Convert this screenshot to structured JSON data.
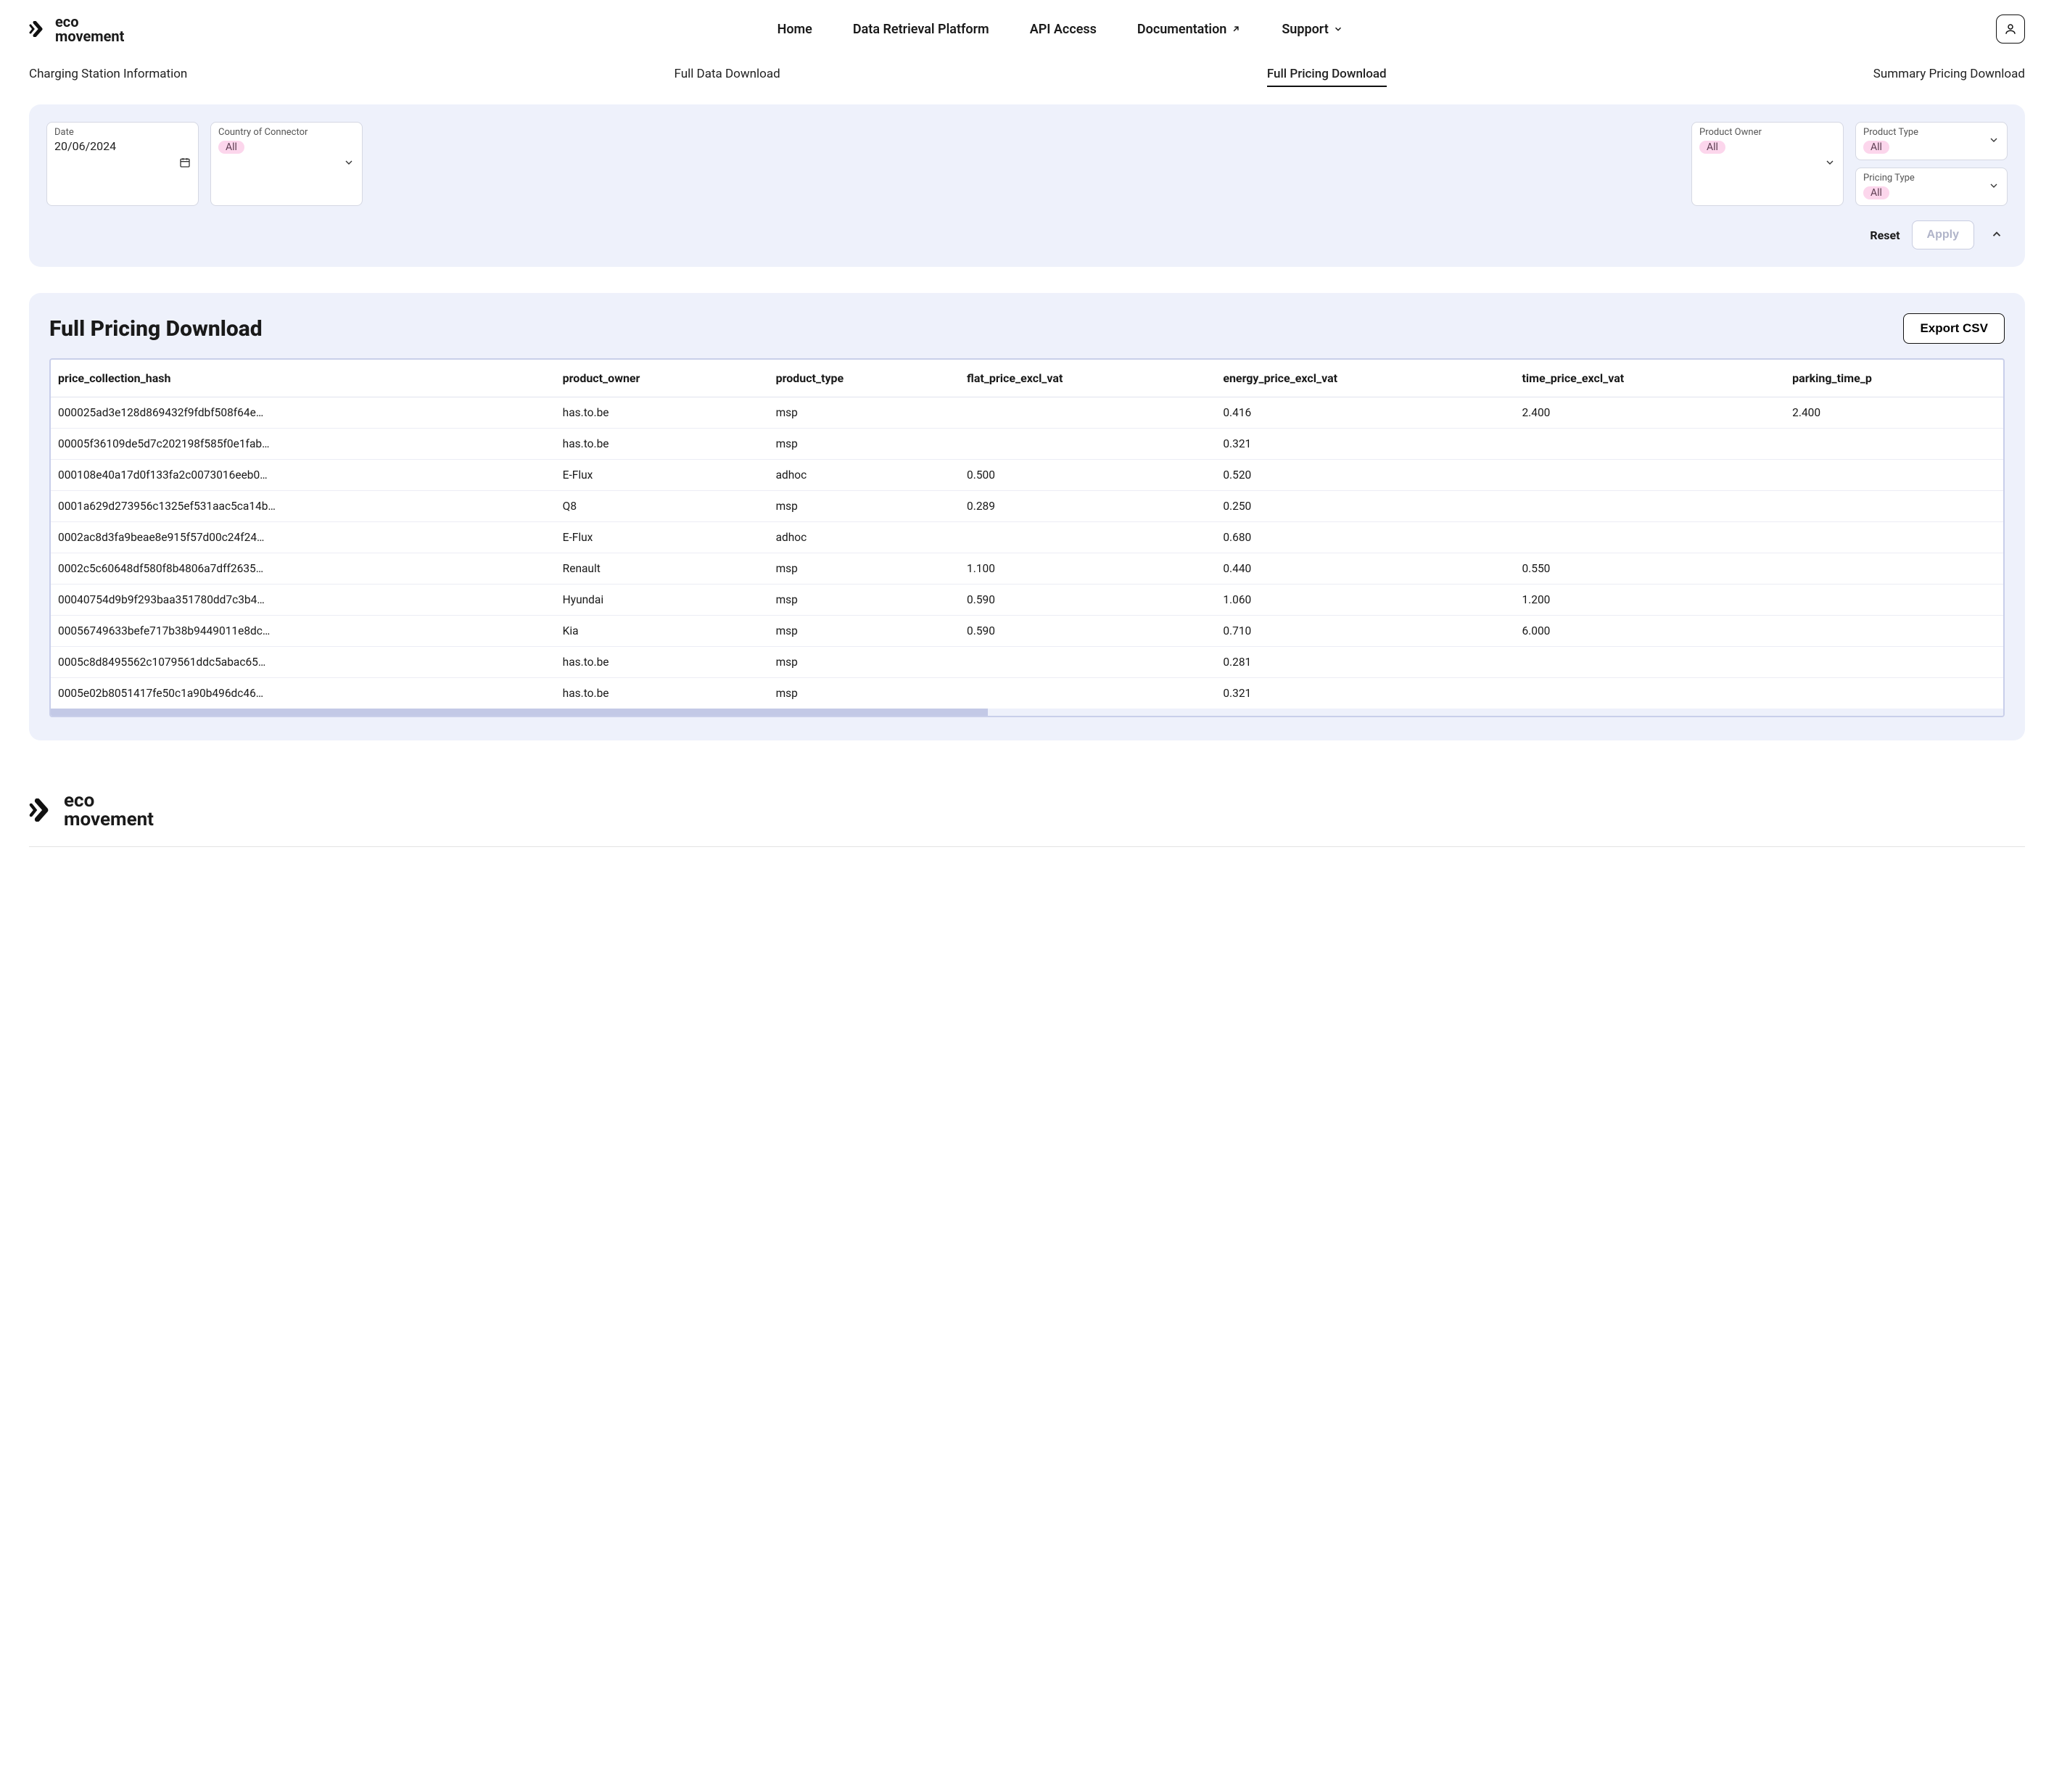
{
  "brand": {
    "line1": "eco",
    "line2": "movement"
  },
  "nav": {
    "home": "Home",
    "drp": "Data Retrieval Platform",
    "api": "API Access",
    "docs": "Documentation",
    "support": "Support"
  },
  "subtabs": {
    "charging": "Charging Station Information",
    "full_data": "Full Data Download",
    "full_pricing": "Full Pricing Download",
    "summary_pricing": "Summary Pricing Download"
  },
  "filters": {
    "date_label": "Date",
    "date_value": "20/06/2024",
    "country_label": "Country of Connector",
    "country_value": "All",
    "owner_label": "Product Owner",
    "owner_value": "All",
    "ptype_label": "Product Type",
    "ptype_value": "All",
    "pricing_label": "Pricing Type",
    "pricing_value": "All",
    "reset": "Reset",
    "apply": "Apply"
  },
  "data_section": {
    "title": "Full Pricing Download",
    "export": "Export CSV"
  },
  "columns": [
    "price_collection_hash",
    "product_owner",
    "product_type",
    "flat_price_excl_vat",
    "energy_price_excl_vat",
    "time_price_excl_vat",
    "parking_time_p"
  ],
  "rows": [
    {
      "hash": "000025ad3e128d869432f9fdbf508f64e…",
      "owner": "has.to.be",
      "ptype": "msp",
      "flat": "",
      "energy": "0.416",
      "time": "2.400",
      "parking": "2.400"
    },
    {
      "hash": "00005f36109de5d7c202198f585f0e1fab…",
      "owner": "has.to.be",
      "ptype": "msp",
      "flat": "",
      "energy": "0.321",
      "time": "",
      "parking": ""
    },
    {
      "hash": "000108e40a17d0f133fa2c0073016eeb0…",
      "owner": "E-Flux",
      "ptype": "adhoc",
      "flat": "0.500",
      "energy": "0.520",
      "time": "",
      "parking": ""
    },
    {
      "hash": "0001a629d273956c1325ef531aac5ca14b…",
      "owner": "Q8",
      "ptype": "msp",
      "flat": "0.289",
      "energy": "0.250",
      "time": "",
      "parking": ""
    },
    {
      "hash": "0002ac8d3fa9beae8e915f57d00c24f24…",
      "owner": "E-Flux",
      "ptype": "adhoc",
      "flat": "",
      "energy": "0.680",
      "time": "",
      "parking": ""
    },
    {
      "hash": "0002c5c60648df580f8b4806a7dff2635…",
      "owner": "Renault",
      "ptype": "msp",
      "flat": "1.100",
      "energy": "0.440",
      "time": "0.550",
      "parking": ""
    },
    {
      "hash": "00040754d9b9f293baa351780dd7c3b4…",
      "owner": "Hyundai",
      "ptype": "msp",
      "flat": "0.590",
      "energy": "1.060",
      "time": "1.200",
      "parking": ""
    },
    {
      "hash": "00056749633befe717b38b9449011e8dc…",
      "owner": "Kia",
      "ptype": "msp",
      "flat": "0.590",
      "energy": "0.710",
      "time": "6.000",
      "parking": ""
    },
    {
      "hash": "0005c8d8495562c1079561ddc5abac65…",
      "owner": "has.to.be",
      "ptype": "msp",
      "flat": "",
      "energy": "0.281",
      "time": "",
      "parking": ""
    },
    {
      "hash": "0005e02b8051417fe50c1a90b496dc46…",
      "owner": "has.to.be",
      "ptype": "msp",
      "flat": "",
      "energy": "0.321",
      "time": "",
      "parking": ""
    }
  ]
}
